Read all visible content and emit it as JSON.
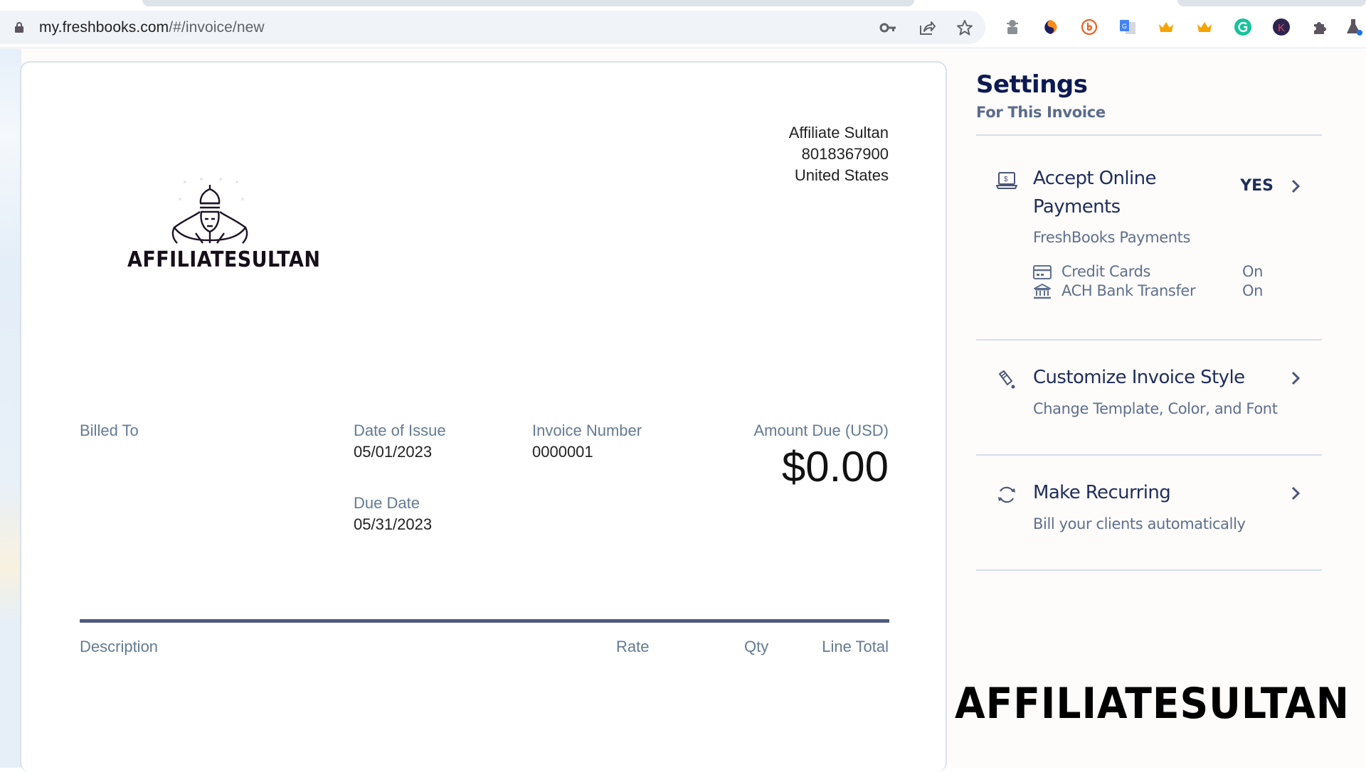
{
  "browser": {
    "url_host": "my.freshbooks.com",
    "url_path": "/#/invoice/new",
    "omnibox_icons": [
      "key-icon",
      "share-icon",
      "bookmark-star-icon"
    ],
    "extensions": [
      "spy-extension-icon",
      "semrush-extension-icon",
      "bitly-extension-icon",
      "google-translate-extension-icon",
      "crown-extension-icon",
      "crown-extension-icon-2",
      "grammarly-extension-icon",
      "k-extension-icon",
      "extensions-puzzle-icon",
      "labs-flask-icon"
    ]
  },
  "invoice": {
    "logo_text": "AFFILIATESULTAN",
    "from": {
      "name": "Affiliate Sultan",
      "phone": "8018367900",
      "country": "United States"
    },
    "billed_to_label": "Billed To",
    "date_of_issue_label": "Date of Issue",
    "date_of_issue": "05/01/2023",
    "due_date_label": "Due Date",
    "due_date": "05/31/2023",
    "invoice_number_label": "Invoice Number",
    "invoice_number": "0000001",
    "amount_due_label": "Amount Due (USD)",
    "amount_due": "$0.00",
    "columns": [
      "Description",
      "Rate",
      "Qty",
      "Line Total"
    ]
  },
  "settings": {
    "title": "Settings",
    "subtitle": "For This Invoice",
    "items": [
      {
        "label_line1": "Accept Online",
        "label_line2": "Payments",
        "value": "YES",
        "provider": "FreshBooks Payments",
        "methods": [
          {
            "name": "Credit Cards",
            "state": "On"
          },
          {
            "name": "ACH Bank Transfer",
            "state": "On"
          }
        ]
      },
      {
        "label": "Customize Invoice Style",
        "description": "Change Template, Color, and Font"
      },
      {
        "label": "Make Recurring",
        "description": "Bill your clients automatically"
      }
    ]
  },
  "watermark": "AFFILIATESULTAN",
  "colors": {
    "navy": "#0d1a52",
    "label_gray_blue": "#637b94",
    "rule": "#4f5b7c"
  }
}
